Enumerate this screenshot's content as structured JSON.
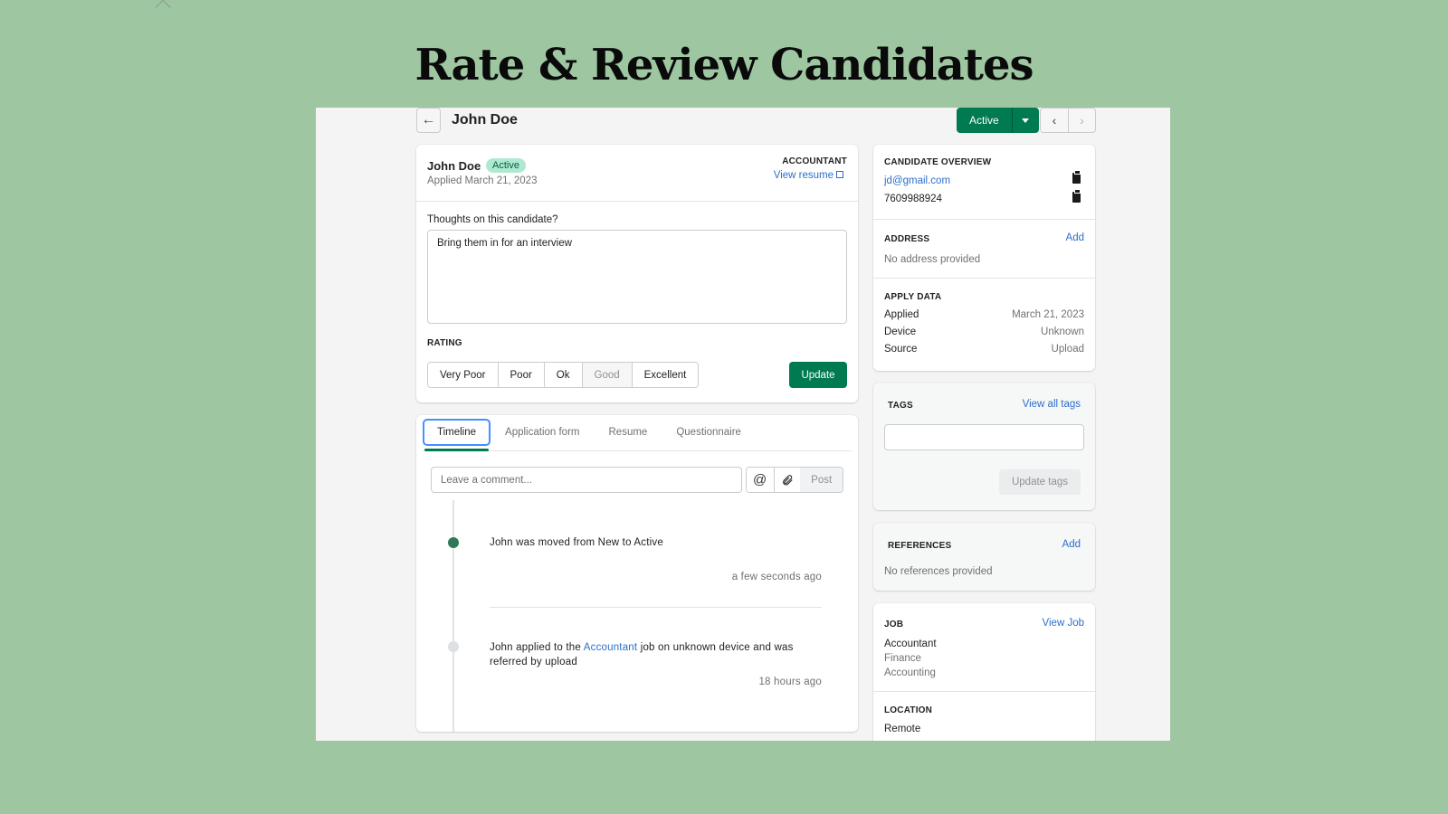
{
  "slide": {
    "title": "Rate & Review Candidates"
  },
  "header": {
    "back_icon": "arrow-left-icon",
    "title": "John Doe",
    "status_button": "Active",
    "status_dropdown_icon": "caret-down-icon",
    "prev_icon": "chevron-left-icon",
    "next_icon": "chevron-right-icon"
  },
  "candidate": {
    "name": "John Doe",
    "status_badge": "Active",
    "applied": "Applied March 21, 2023",
    "job_title": "ACCOUNTANT",
    "view_resume": "View resume",
    "thoughts_label": "Thoughts on this candidate?",
    "thoughts_value": "Bring them in for an interview",
    "rating_label": "RATING",
    "rating_options": [
      "Very Poor",
      "Poor",
      "Ok",
      "Good",
      "Excellent"
    ],
    "rating_selected": "Good",
    "update_button": "Update"
  },
  "timeline": {
    "tabs": [
      "Timeline",
      "Application form",
      "Resume",
      "Questionnaire"
    ],
    "active_tab": "Timeline",
    "comment_placeholder": "Leave a comment...",
    "mention_icon": "at-sign-icon",
    "attach_icon": "paperclip-icon",
    "post_button": "Post",
    "events": [
      {
        "text": "John was moved from New to Active",
        "time": "a few seconds ago",
        "dot": "#2d7a57"
      },
      {
        "text_before": "John applied to the ",
        "link": "Accountant",
        "text_after": " job on unknown device and was referred by upload",
        "time": "18 hours ago",
        "dot": "#dde0e4"
      }
    ]
  },
  "overview": {
    "title": "CANDIDATE OVERVIEW",
    "email": "jd@gmail.com",
    "phone": "7609988924",
    "copy_icon": "clipboard-icon",
    "address": {
      "title": "ADDRESS",
      "action": "Add",
      "value": "No address provided"
    },
    "apply_data": {
      "title": "APPLY DATA",
      "rows": [
        {
          "key": "Applied",
          "value": "March 21, 2023"
        },
        {
          "key": "Device",
          "value": "Unknown"
        },
        {
          "key": "Source",
          "value": "Upload"
        }
      ]
    }
  },
  "tags": {
    "title": "TAGS",
    "action": "View all tags",
    "input_value": "",
    "update_button": "Update tags"
  },
  "references": {
    "title": "REFERENCES",
    "action": "Add",
    "value": "No references provided"
  },
  "job": {
    "title": "JOB",
    "action": "View Job",
    "name": "Accountant",
    "department": "Finance",
    "category": "Accounting",
    "location_title": "LOCATION",
    "location": "Remote"
  },
  "colors": {
    "background": "#9dc6a1",
    "primary": "#007a50",
    "link": "#2c6ecb",
    "badge_bg": "#aee9d1"
  }
}
